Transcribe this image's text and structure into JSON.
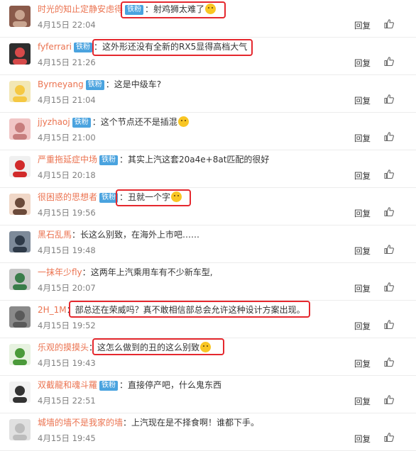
{
  "ui": {
    "reply_label": "回复",
    "badge_label": "铁粉",
    "colon": "："
  },
  "comments": [
    {
      "user": "时光的知止定静安虑得",
      "badge": true,
      "text": "射鸡狮太难了",
      "emoji": "laugh-emoji",
      "time": "4月15日 22:04",
      "highlight": true
    },
    {
      "user": "fyferrari",
      "badge": true,
      "text": "这外形还没有全新的RX5显得高档大气",
      "time": "4月15日 21:26",
      "highlight": true
    },
    {
      "user": "Byrneyang",
      "badge": true,
      "text": "这是中级车?",
      "time": "4月15日 21:04",
      "highlight": false
    },
    {
      "user": "jjyzhaoj",
      "badge": true,
      "text": "这个节点还不是插混",
      "emoji": "doge-emoji",
      "time": "4月15日 21:00",
      "highlight": false
    },
    {
      "user": "严重拖延症中场",
      "badge": true,
      "text": "其实上汽这套20a4e+8at匹配的很好",
      "time": "4月15日 20:18",
      "highlight": false
    },
    {
      "user": "很困惑的思想者",
      "badge": true,
      "text": "丑就一个字",
      "emoji": "smile-emoji",
      "time": "4月15日 19:56",
      "highlight": true
    },
    {
      "user": "黑石乱馬",
      "badge": false,
      "text": "长这么别致，在海外上市吧……",
      "time": "4月15日 19:48",
      "highlight": false
    },
    {
      "user": "一抹年少fly",
      "badge": false,
      "text": "这两年上汽乘用车有不少新车型,",
      "time": "4月15日 20:07",
      "highlight": false
    },
    {
      "user": "2H_1M",
      "badge": false,
      "text": "部总还在荣威吗？真不敢相信部总会允许这种设计方案出现。",
      "time": "4月15日 19:52",
      "highlight": true
    },
    {
      "user": "乐观的摸摸头",
      "badge": false,
      "text": "这怎么做到的丑的这么别致",
      "emoji": "dog-emoji",
      "time": "4月15日 19:43",
      "highlight": true
    },
    {
      "user": "双截龍和魂斗羅",
      "badge": true,
      "text": "直接停产吧，什么鬼东西",
      "time": "4月15日 22:51",
      "highlight": false
    },
    {
      "user": "城墙的墙不是我家的墙",
      "badge": false,
      "text": "上汽现在是不择食啊！谁都下手。",
      "time": "4月15日 19:45",
      "highlight": false
    }
  ],
  "colors": {
    "username": "#eb7350",
    "badge": "#4aa3df",
    "highlight": "#e5282e",
    "time": "#808080"
  }
}
